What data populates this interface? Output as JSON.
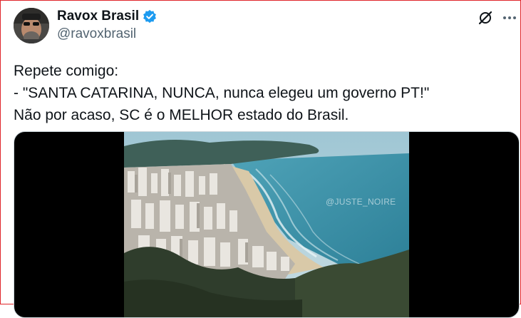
{
  "author": {
    "name": "Ravox Brasil",
    "handle": "@ravoxbrasil"
  },
  "icons": {
    "verified": "verified-badge-icon",
    "grok": "grok-icon",
    "more": "more-options-icon"
  },
  "tweet": {
    "lines": [
      "Repete comigo:",
      "- \"SANTA CATARINA, NUNCA, nunca elegeu um governo PT!\"",
      "Não por acaso, SC é o MELHOR estado do Brasil."
    ]
  },
  "media": {
    "watermark": "@JUSTE_NOIRE"
  },
  "colors": {
    "verified": "#1d9bf0",
    "frame_border": "#e0262b",
    "handle": "#536471"
  }
}
